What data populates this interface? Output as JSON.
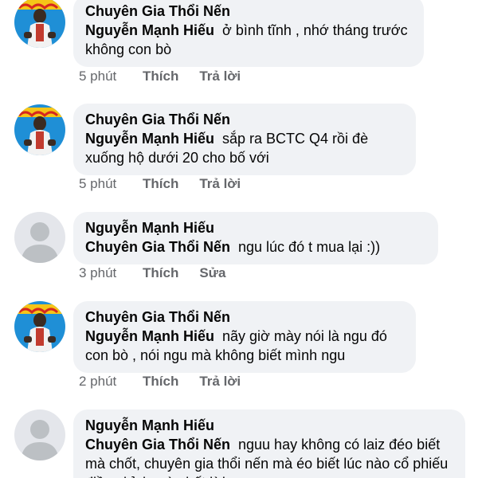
{
  "comments": [
    {
      "author": "Chuyên Gia Thổi Nến",
      "mention": "Nguyễn Mạnh Hiếu",
      "text": "ở bình tĩnh , nhớ tháng trước không con bò",
      "time": "5 phút",
      "actions": [
        "Thích",
        "Trả lời"
      ],
      "avatar": "person-photo-icon"
    },
    {
      "author": "Chuyên Gia Thổi Nến",
      "mention": "Nguyễn Mạnh Hiếu",
      "text": "sắp ra BCTC Q4 rồi đè xuống hộ dưới 20 cho bố với",
      "time": "5 phút",
      "actions": [
        "Thích",
        "Trả lời"
      ],
      "avatar": "person-photo-icon"
    },
    {
      "author": "Nguyễn Mạnh Hiếu",
      "mention": "Chuyên Gia Thổi Nến",
      "text": "ngu lúc đó t mua lại :))",
      "time": "3 phút",
      "actions": [
        "Thích",
        "Sửa"
      ],
      "avatar": "default-profile-icon"
    },
    {
      "author": "Chuyên Gia Thổi Nến",
      "mention": "Nguyễn Mạnh Hiếu",
      "text": "nãy giờ mày nói là ngu đó con bò , nói ngu mà không biết mình ngu",
      "time": "2 phút",
      "actions": [
        "Thích",
        "Trả lời"
      ],
      "avatar": "person-photo-icon"
    },
    {
      "author": "Nguyễn Mạnh Hiếu",
      "mention": "Chuyên Gia Thổi Nến",
      "text": "nguu hay không có laiz đéo biết mà chốt, chuyên gia thổi nến mà éo biết lúc nào cổ phiếu điều chỉnh mà chốt lời",
      "time": "",
      "actions": [],
      "avatar": "default-profile-icon"
    }
  ],
  "colors": {
    "bubble": "#f0f2f5",
    "text": "#050505",
    "meta": "#65676b",
    "default_avatar_bg": "#e4e6eb",
    "default_avatar_fg": "#bcc0c4"
  }
}
